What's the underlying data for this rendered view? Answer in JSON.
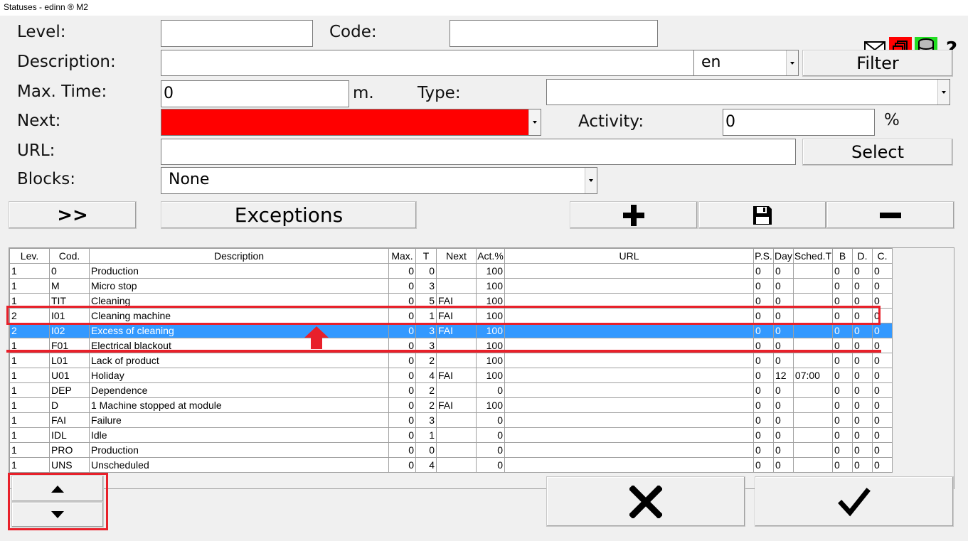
{
  "window": {
    "title": "Statuses - edinn ® M2"
  },
  "form": {
    "level_label": "Level:",
    "level_value": "",
    "code_label": "Code:",
    "code_value": "",
    "description_label": "Description:",
    "description_value": "",
    "language_value": "en",
    "filter_label": "Filter",
    "maxtime_label": "Max. Time:",
    "maxtime_value": "0",
    "maxtime_unit": "m.",
    "type_label": "Type:",
    "type_value": "",
    "next_label": "Next:",
    "next_value": "",
    "next_color": "#ff0000",
    "activity_label": "Activity:",
    "activity_value": "0",
    "activity_unit": "%",
    "url_label": "URL:",
    "url_value": "",
    "select_label": "Select",
    "blocks_label": "Blocks:",
    "blocks_value": "None"
  },
  "top_icons": [
    "mail-icon",
    "windows-icon",
    "database-icon",
    "help-icon"
  ],
  "toolbar": {
    "expand_label": ">>",
    "exceptions_label": "Exceptions",
    "add_icon": "plus-icon",
    "save_icon": "save-icon",
    "remove_icon": "minus-icon"
  },
  "grid": {
    "columns": [
      "Lev.",
      "Cod.",
      "Description",
      "Max.",
      "T",
      "Next",
      "Act.%",
      "URL",
      "P.S.",
      "Day",
      "Sched.T",
      "B",
      "D.",
      "C."
    ],
    "rows": [
      [
        "1",
        "0",
        "Production",
        "0",
        "0",
        "",
        "100",
        "",
        "0",
        "0",
        "",
        "0",
        "0",
        "0"
      ],
      [
        "1",
        "M",
        "Micro stop",
        "0",
        "3",
        "",
        "100",
        "",
        "0",
        "0",
        "",
        "0",
        "0",
        "0"
      ],
      [
        "1",
        "TIT",
        "Cleaning",
        "0",
        "5",
        "FAI",
        "100",
        "",
        "0",
        "0",
        "",
        "0",
        "0",
        "0"
      ],
      [
        "2",
        "I01",
        "Cleaning machine",
        "0",
        "1",
        "FAI",
        "100",
        "",
        "0",
        "0",
        "",
        "0",
        "0",
        "0"
      ],
      [
        "2",
        "I02",
        "Excess of cleaning",
        "0",
        "3",
        "FAI",
        "100",
        "",
        "0",
        "0",
        "",
        "0",
        "0",
        "0"
      ],
      [
        "1",
        "F01",
        "Electrical blackout",
        "0",
        "3",
        "",
        "100",
        "",
        "0",
        "0",
        "",
        "0",
        "0",
        "0"
      ],
      [
        "1",
        "L01",
        "Lack of product",
        "0",
        "2",
        "",
        "100",
        "",
        "0",
        "0",
        "",
        "0",
        "0",
        "0"
      ],
      [
        "1",
        "U01",
        "Holiday",
        "0",
        "4",
        "FAI",
        "100",
        "",
        "0",
        "12",
        "07:00",
        "0",
        "0",
        "0"
      ],
      [
        "1",
        "DEP",
        "Dependence",
        "0",
        "2",
        "",
        "0",
        "",
        "0",
        "0",
        "",
        "0",
        "0",
        "0"
      ],
      [
        "1",
        "D",
        "1 Machine stopped at module",
        "0",
        "2",
        "FAI",
        "100",
        "",
        "0",
        "0",
        "",
        "0",
        "0",
        "0"
      ],
      [
        "1",
        "FAI",
        "Failure",
        "0",
        "3",
        "",
        "0",
        "",
        "0",
        "0",
        "",
        "0",
        "0",
        "0"
      ],
      [
        "1",
        "IDL",
        "Idle",
        "0",
        "1",
        "",
        "0",
        "",
        "0",
        "0",
        "",
        "0",
        "0",
        "0"
      ],
      [
        "1",
        "PRO",
        "Production",
        "0",
        "0",
        "",
        "0",
        "",
        "0",
        "0",
        "",
        "0",
        "0",
        "0"
      ],
      [
        "1",
        "UNS",
        "Unscheduled",
        "0",
        "4",
        "",
        "0",
        "",
        "0",
        "0",
        "",
        "0",
        "0",
        "0"
      ]
    ],
    "selected_row": 4
  },
  "bottom": {
    "move_up_icon": "triangle-up-icon",
    "move_down_icon": "triangle-down-icon",
    "cancel_icon": "x-icon",
    "accept_icon": "check-icon"
  },
  "highlight_color": "#e8202a"
}
